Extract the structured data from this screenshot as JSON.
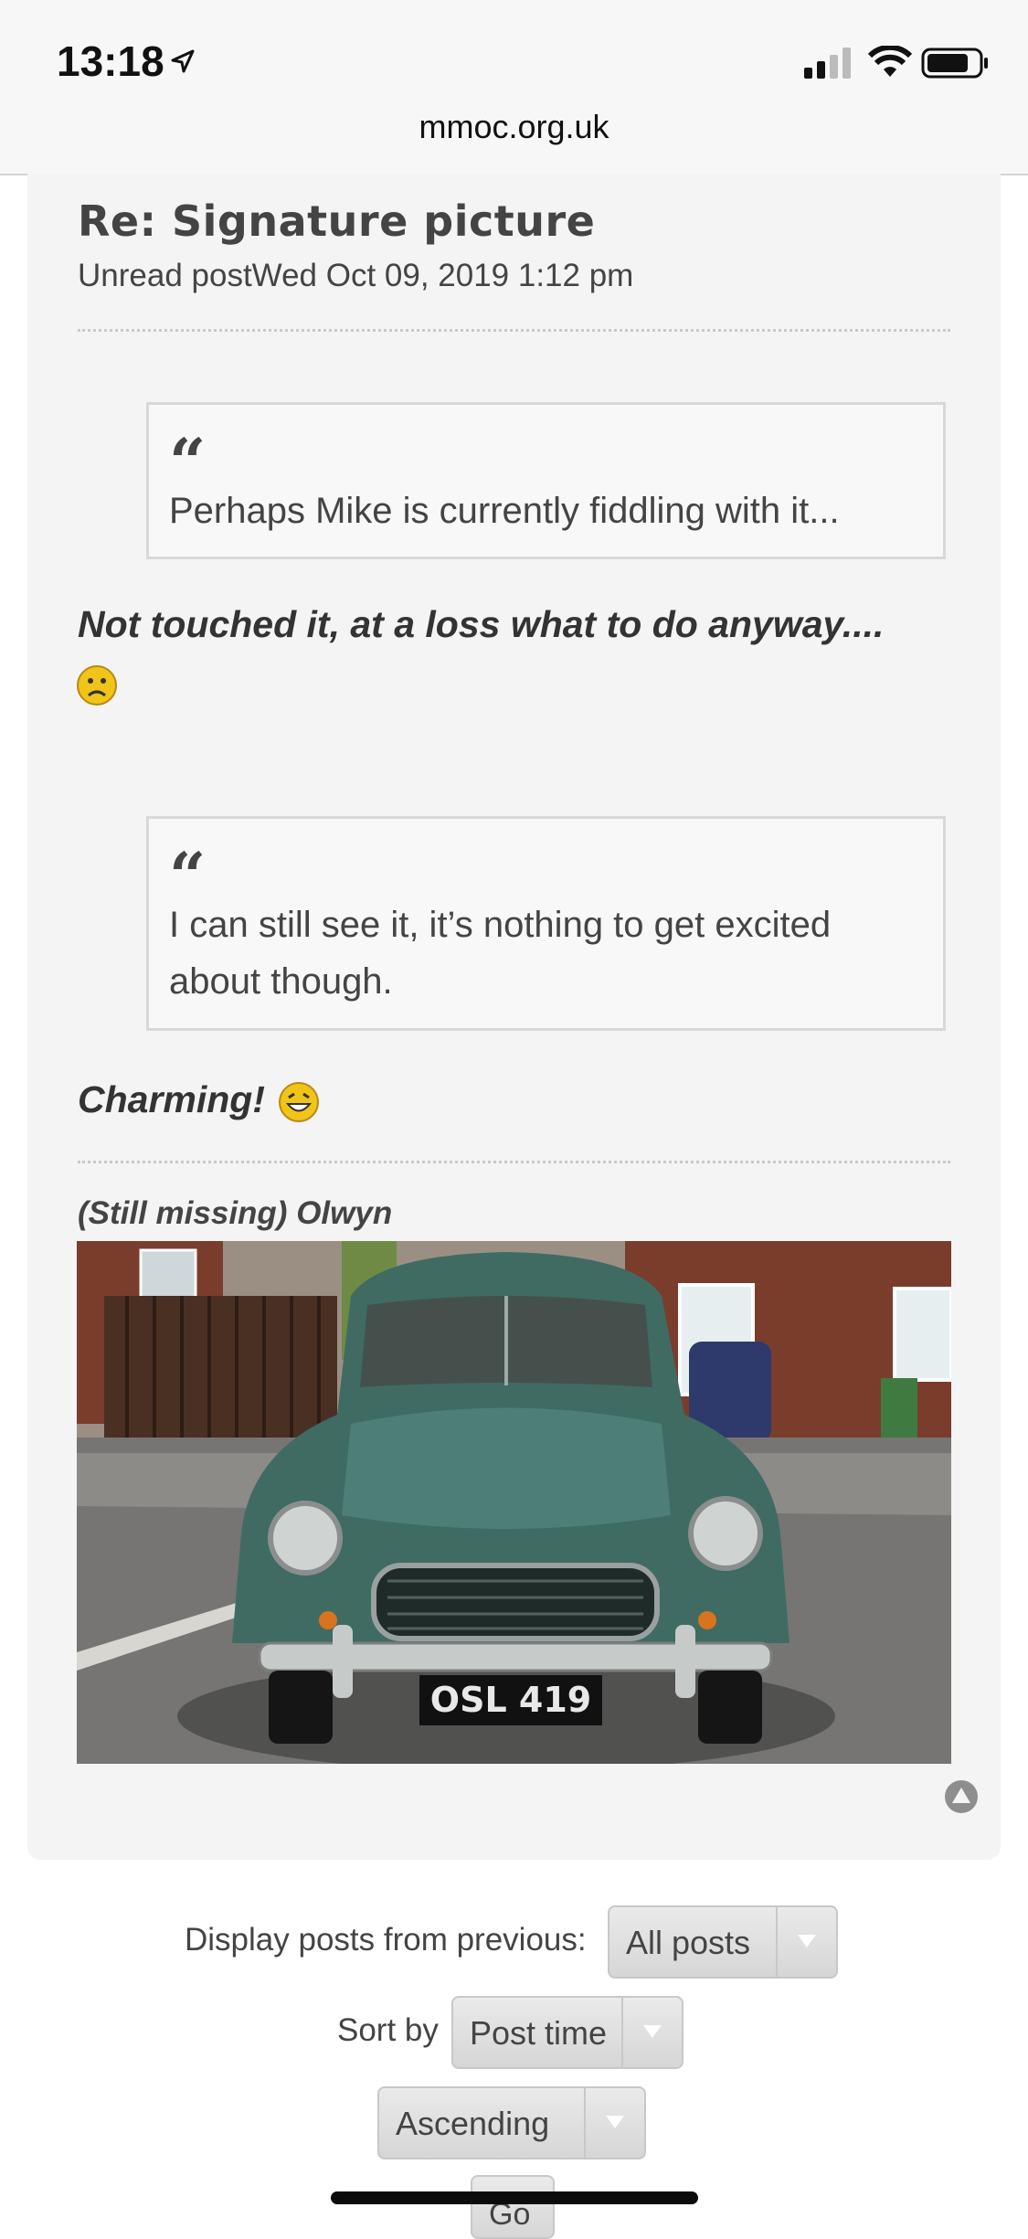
{
  "status_bar": {
    "time": "13:18"
  },
  "browser": {
    "url": "mmoc.org.uk"
  },
  "post": {
    "title": "Re: Signature picture",
    "meta": "Unread postWed Oct 09, 2019 1:12 pm",
    "quote1": "Perhaps Mike is currently fiddling with it...",
    "reply1": "Not touched it, at a loss what to do anyway....",
    "quote2": "I can still see it, it’s nothing to get excited about though.",
    "reply2": "Charming!",
    "signature_name": "(Still missing) Olwyn",
    "plate": "OSL 419"
  },
  "controls": {
    "display_label": "Display posts from previous:",
    "display_value": "All posts",
    "sort_label": "Sort by",
    "sort_value": "Post time",
    "order_value": "Ascending",
    "go_label": "Go"
  },
  "colors": {
    "car": "#3f6b63",
    "quote_icon": "#444444",
    "smiley": "#f0c419"
  },
  "icons": {
    "quote": "quote-icon",
    "sad": "sad-smiley-icon",
    "happy": "laughing-smiley-icon",
    "top": "scroll-to-top-icon"
  }
}
